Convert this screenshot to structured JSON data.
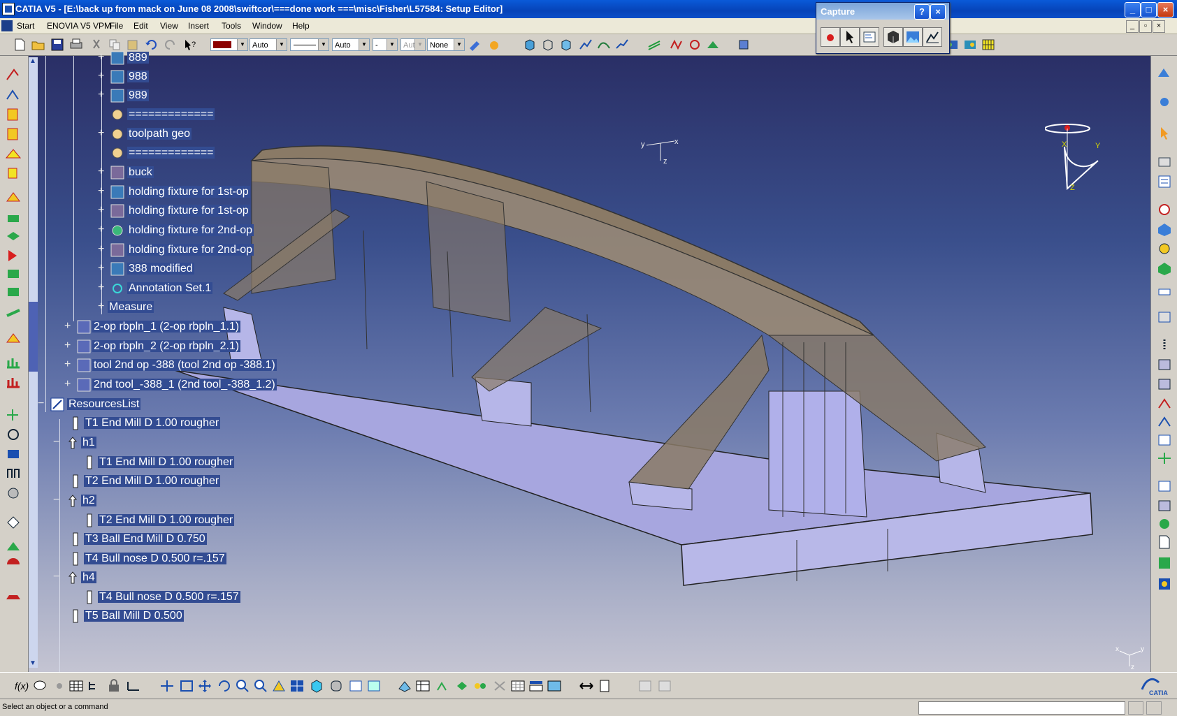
{
  "window": {
    "title": "CATIA V5 - [E:\\back up from mack on June 08 2008\\swiftcor\\===done work ===\\misc\\Fisher\\L57584: Setup Editor]",
    "minimize": "_",
    "maximize": "□",
    "close": "×"
  },
  "menubar": {
    "items": [
      "Start",
      "ENOVIA V5 VPM",
      "File",
      "Edit",
      "View",
      "Insert",
      "Tools",
      "Window",
      "Help"
    ]
  },
  "toolbar": {
    "line_thickness": "Auto",
    "line_type": "Auto",
    "layer_dot": "-",
    "layer_auto": "Aut",
    "rendering": "None"
  },
  "capture": {
    "title": "Capture",
    "help": "?",
    "close": "×"
  },
  "tree": {
    "nodes": [
      "889",
      "988",
      "989",
      "=============",
      "toolpath geo",
      "=============",
      "buck",
      "holding fixture for 1st-op",
      "holding fixture for 1st-op",
      "holding fixture for 2nd-op",
      "holding fixture for 2nd-op",
      "388 modified",
      "Annotation Set.1",
      "Measure",
      "2-op rbpln_1 (2-op rbpln_1.1)",
      "2-op rbpln_2 (2-op rbpln_2.1)",
      "tool 2nd op -388 (tool 2nd op -388.1)",
      "2nd tool_-388_1 (2nd tool_-388_1.2)",
      "ResourcesList",
      "T1 End Mill D 1.00 rougher",
      "h1",
      "T1 End Mill D 1.00 rougher",
      "T2 End Mill D 1.00 rougher",
      "h2",
      "T2 End Mill D 1.00 rougher",
      "T3 Ball End Mill D 0.750",
      "T4 Bull nose D 0.500 r=.157",
      "h4",
      "T4 Bull nose D 0.500 r=.157",
      "T5 Ball Mill D 0.500"
    ]
  },
  "axes": {
    "compass_y": "Y",
    "compass_x": "X",
    "compass_z": "Z",
    "triad_y": "y",
    "triad_x": "x",
    "triad_z": "z",
    "corner_x": "x",
    "corner_y": "y",
    "corner_z": "z"
  },
  "brand": {
    "logo_text": "CATIA"
  },
  "status": {
    "message": "Select an object or a command"
  },
  "colors": {
    "title_bar": "#0643b8",
    "tree_highlight": "#334c92",
    "viewport_top": "#2a2f66",
    "viewport_bottom": "#c4c4d2",
    "part_fill": "#8a7a66",
    "base_fill": "#a6a6e0"
  }
}
